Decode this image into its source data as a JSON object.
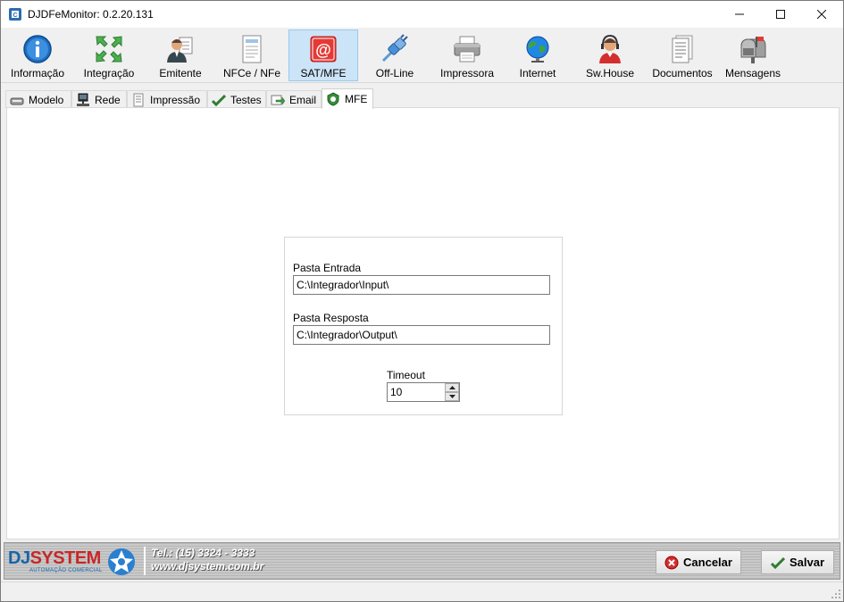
{
  "window": {
    "title": "DJDFeMonitor: 0.2.20.131"
  },
  "toolbar": {
    "items": [
      {
        "label": "Informação",
        "icon": "info-icon",
        "active": false
      },
      {
        "label": "Integração",
        "icon": "integration-arrows-icon",
        "active": false
      },
      {
        "label": "Emitente",
        "icon": "person-icon",
        "active": false
      },
      {
        "label": "NFCe / NFe",
        "icon": "document-icon",
        "active": false
      },
      {
        "label": "SAT/MFE",
        "icon": "at-sign-icon",
        "active": true
      },
      {
        "label": "Off-Line",
        "icon": "plug-icon",
        "active": false
      },
      {
        "label": "Impressora",
        "icon": "printer-icon",
        "active": false
      },
      {
        "label": "Internet",
        "icon": "globe-icon",
        "active": false
      },
      {
        "label": "Sw.House",
        "icon": "headset-person-icon",
        "active": false
      },
      {
        "label": "Documentos",
        "icon": "documents-icon",
        "active": false
      },
      {
        "label": "Mensagens",
        "icon": "mailbox-icon",
        "active": false
      }
    ]
  },
  "tabs": [
    {
      "label": "Modelo",
      "icon": "device-icon",
      "active": false
    },
    {
      "label": "Rede",
      "icon": "network-icon",
      "active": false
    },
    {
      "label": "Impressão",
      "icon": "print-page-icon",
      "active": false
    },
    {
      "label": "Testes",
      "icon": "checkmark-icon",
      "active": false
    },
    {
      "label": "Email",
      "icon": "email-arrow-icon",
      "active": false
    },
    {
      "label": "MFE",
      "icon": "mfe-icon",
      "active": true
    }
  ],
  "form": {
    "input_folder_label": "Pasta Entrada",
    "input_folder_value": "C:\\Integrador\\Input\\",
    "output_folder_label": "Pasta Resposta",
    "output_folder_value": "C:\\Integrador\\Output\\",
    "timeout_label": "Timeout",
    "timeout_value": "10"
  },
  "footer": {
    "brand_dj": "DJ",
    "brand_system": "SYSTEM",
    "brand_sub": "AUTOMAÇÃO COMERCIAL",
    "phone": "Tel.: (15) 3324 - 3333",
    "website": "www.djsystem.com.br",
    "cancel_label": "Cancelar",
    "save_label": "Salvar"
  },
  "colors": {
    "active_tool_bg": "#cce4f7",
    "brand_blue": "#1565a8",
    "brand_red": "#c62828",
    "cancel_icon": "#d32f2f",
    "save_icon": "#2e7d32"
  }
}
